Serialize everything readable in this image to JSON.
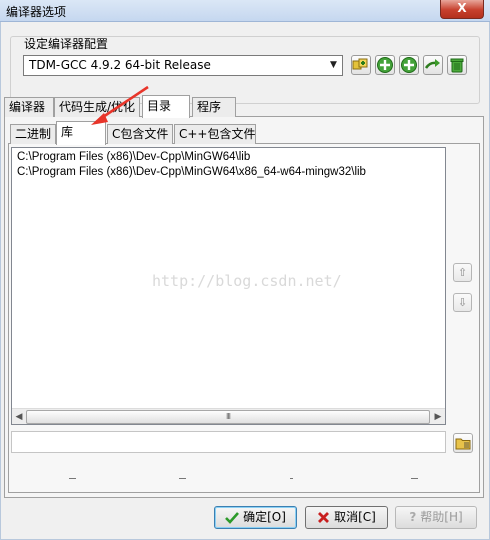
{
  "window": {
    "title": "编译器选项",
    "close_label": "X"
  },
  "compiler_group": {
    "label": "设定编译器配置",
    "selected": "TDM-GCC 4.9.2 64-bit Release"
  },
  "main_tabs": [
    "编译器",
    "代码生成/优化",
    "目录",
    "程序"
  ],
  "dir_tabs": [
    "二进制",
    "库",
    "C包含文件",
    "C++包含文件"
  ],
  "directories": [
    "C:\\Program Files (x86)\\Dev-Cpp\\MinGW64\\lib",
    "C:\\Program Files (x86)\\Dev-Cpp\\MinGW64\\x86_64-w64-mingw32\\lib"
  ],
  "scroll": {
    "thumb_grip": "III"
  },
  "watermark": "http://blog.csdn.net/",
  "path_input": {
    "value": ""
  },
  "buttons": {
    "ok": "确定[O]",
    "cancel": "取消[C]",
    "help": "帮助[H]"
  },
  "colors": {
    "active_accent": "#3c7fb1",
    "annotation_arrow": "#e8352a"
  }
}
